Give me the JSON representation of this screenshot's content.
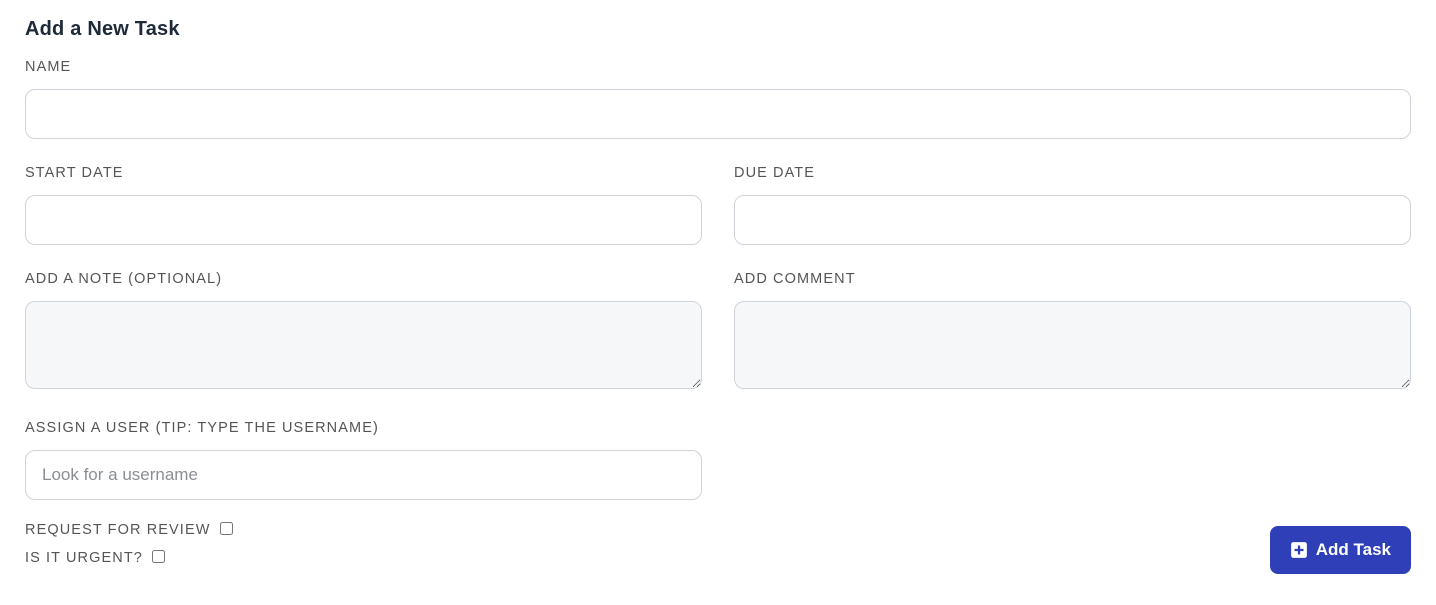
{
  "title": "Add a New Task",
  "fields": {
    "name": {
      "label": "NAME",
      "value": ""
    },
    "start_date": {
      "label": "START DATE",
      "value": ""
    },
    "due_date": {
      "label": "DUE DATE",
      "value": ""
    },
    "note": {
      "label": "ADD A NOTE (OPTIONAL)",
      "value": ""
    },
    "comment": {
      "label": "ADD COMMENT",
      "value": ""
    },
    "assign": {
      "label": "ASSIGN A USER (TIP: TYPE THE USERNAME)",
      "placeholder": "Look for a username",
      "value": ""
    }
  },
  "checks": {
    "review": {
      "label": "REQUEST FOR REVIEW",
      "checked": false
    },
    "urgent": {
      "label": "IS IT URGENT?",
      "checked": false
    }
  },
  "buttons": {
    "add_task": "Add Task"
  }
}
